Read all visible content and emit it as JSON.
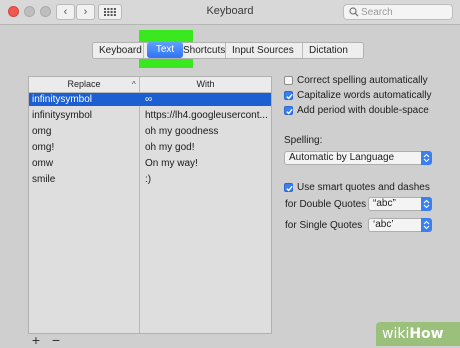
{
  "window": {
    "title": "Keyboard"
  },
  "search": {
    "placeholder": "Search"
  },
  "tabs": [
    "Keyboard",
    "Text",
    "Shortcuts",
    "Input Sources",
    "Dictation"
  ],
  "active_tab": "Text",
  "table": {
    "headers": {
      "replace": "Replace",
      "with": "With"
    },
    "rows": [
      {
        "replace": "infinitysymbol",
        "with": "∞",
        "selected": true
      },
      {
        "replace": "infinitysymbol",
        "with": "https://lh4.googleusercont..."
      },
      {
        "replace": "omg",
        "with": "oh my goodness"
      },
      {
        "replace": "omg!",
        "with": "oh my god!"
      },
      {
        "replace": "omw",
        "with": "On my way!"
      },
      {
        "replace": "smile",
        "with": ":)"
      }
    ],
    "add_label": "+",
    "remove_label": "−"
  },
  "options": {
    "correct_spelling": {
      "label": "Correct spelling automatically",
      "checked": false
    },
    "capitalize": {
      "label": "Capitalize words automatically",
      "checked": true
    },
    "period": {
      "label": "Add period with double-space",
      "checked": true
    },
    "spelling_label": "Spelling:",
    "spelling_value": "Automatic by Language",
    "smart_quotes": {
      "label": "Use smart quotes and dashes",
      "checked": true
    },
    "double_label": "for Double Quotes",
    "double_value": "“abc”",
    "single_label": "for Single Quotes",
    "single_value": "‘abc’"
  },
  "watermark": {
    "wiki": "wiki",
    "how": "How"
  },
  "colors": {
    "accent": "#3a7ff0",
    "selection": "#1c5fd2",
    "highlight": "#39e81f"
  }
}
